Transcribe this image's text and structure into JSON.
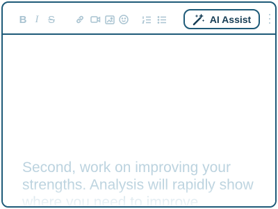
{
  "toolbar": {
    "bold_label": "B",
    "italic_label": "I",
    "strike_label": "S",
    "ai_assist_label": "AI Assist",
    "icons": [
      "bold-icon",
      "italic-icon",
      "strikethrough-icon",
      "link-icon",
      "video-icon",
      "image-icon",
      "emoji-icon",
      "ordered-list-icon",
      "bullet-list-icon",
      "magic-wand-icon",
      "more-vertical-icon"
    ]
  },
  "editor": {
    "text": "Second, work on improving your strengths. Analysis will rapidly show where you need to improve"
  },
  "colors": {
    "border": "#1e5a78",
    "icon": "#a9c3d1",
    "text": "#bcd3df",
    "button_text": "#163d55"
  }
}
